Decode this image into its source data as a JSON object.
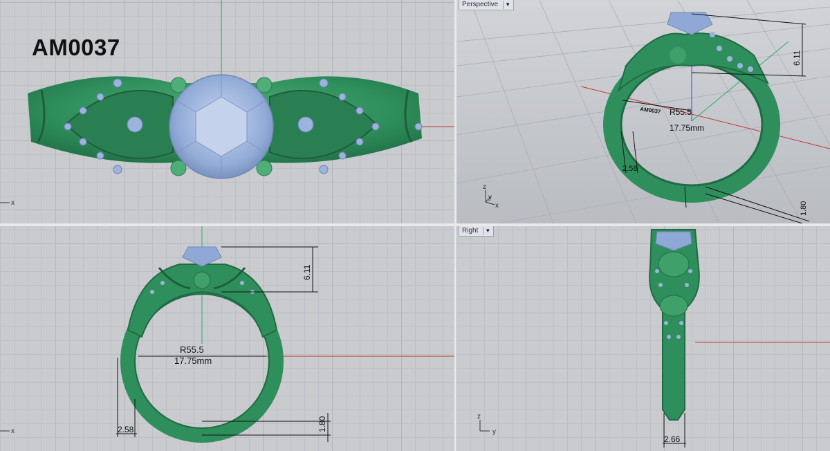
{
  "model_code": "AM0037",
  "viewports": {
    "perspective": {
      "title": "Perspective",
      "dims": {
        "radius": "R55.5",
        "diameter": "17.75mm",
        "height": "6.11",
        "shank_width": "2.58",
        "shank_thickness": "1.80",
        "label_on_model": "AM0037"
      }
    },
    "front": {
      "dims": {
        "radius": "R55.5",
        "diameter": "17.75mm",
        "height": "6.11",
        "shank_width": "2.58",
        "shank_thickness": "1.80"
      }
    },
    "right": {
      "title": "Right",
      "dims": {
        "band_width": "2.66"
      }
    }
  },
  "axes": {
    "x": "x",
    "y": "y",
    "z": "z"
  },
  "colors": {
    "metal": "#2f8f5c",
    "stone": "#8fa8d6",
    "x_axis": "#c0392b",
    "y_axis": "#27ae60",
    "z_axis": "#3a4fd0"
  }
}
